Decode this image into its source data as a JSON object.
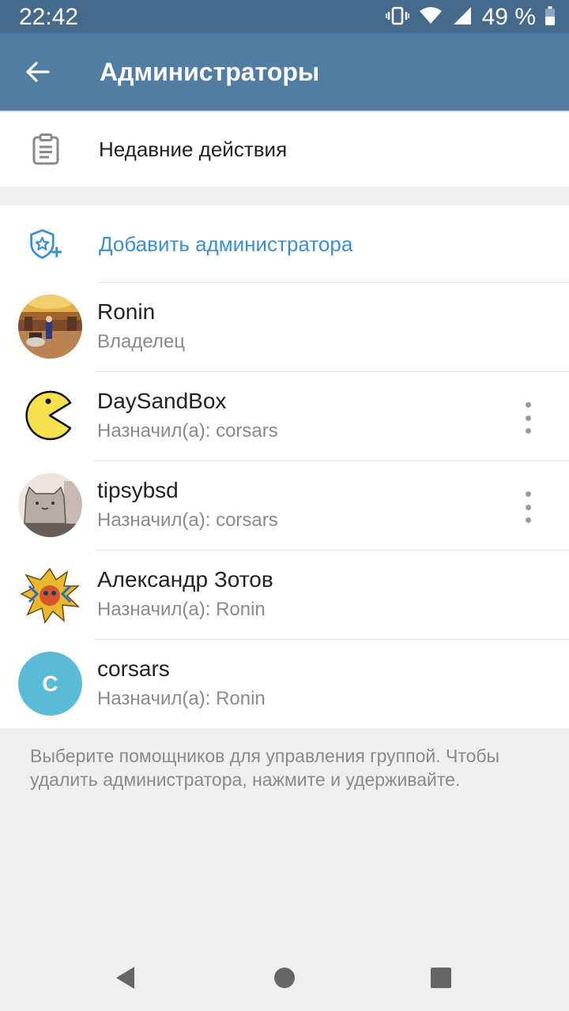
{
  "status_bar": {
    "time": "22:42",
    "battery": "49 %",
    "icons": [
      "vibrate-icon",
      "wifi-icon",
      "signal-icon",
      "battery-icon"
    ]
  },
  "app_bar": {
    "title": "Администраторы",
    "back_icon": "arrow-left-icon"
  },
  "recent_actions": {
    "label": "Недавние действия",
    "icon": "clipboard-icon"
  },
  "add_admin": {
    "label": "Добавить администратора",
    "icon": "shield-star-plus-icon"
  },
  "admins": [
    {
      "name": "Ronin",
      "role": "Владелец",
      "avatar": "photo",
      "has_menu": false
    },
    {
      "name": "DaySandBox",
      "role": "Назначил(а): corsars",
      "avatar": "pacman",
      "has_menu": true
    },
    {
      "name": "tipsybsd",
      "role": "Назначил(а): corsars",
      "avatar": "cat",
      "has_menu": true
    },
    {
      "name": "Александр Зотов",
      "role": "Назначил(а): Ronin",
      "avatar": "drawing",
      "has_menu": false
    },
    {
      "name": "corsars",
      "role": "Назначил(а): Ronin",
      "avatar": "letter",
      "avatar_letter": "C",
      "has_menu": false
    }
  ],
  "footer": "Выберите помощников для управления группой. Чтобы удалить администратора, нажмите и удерживайте.",
  "colors": {
    "status_bar": "#456a8b",
    "app_bar": "#527da3",
    "accent": "#3a8fd3",
    "letter_avatar": "#5bbbd7",
    "background": "#efefef"
  }
}
